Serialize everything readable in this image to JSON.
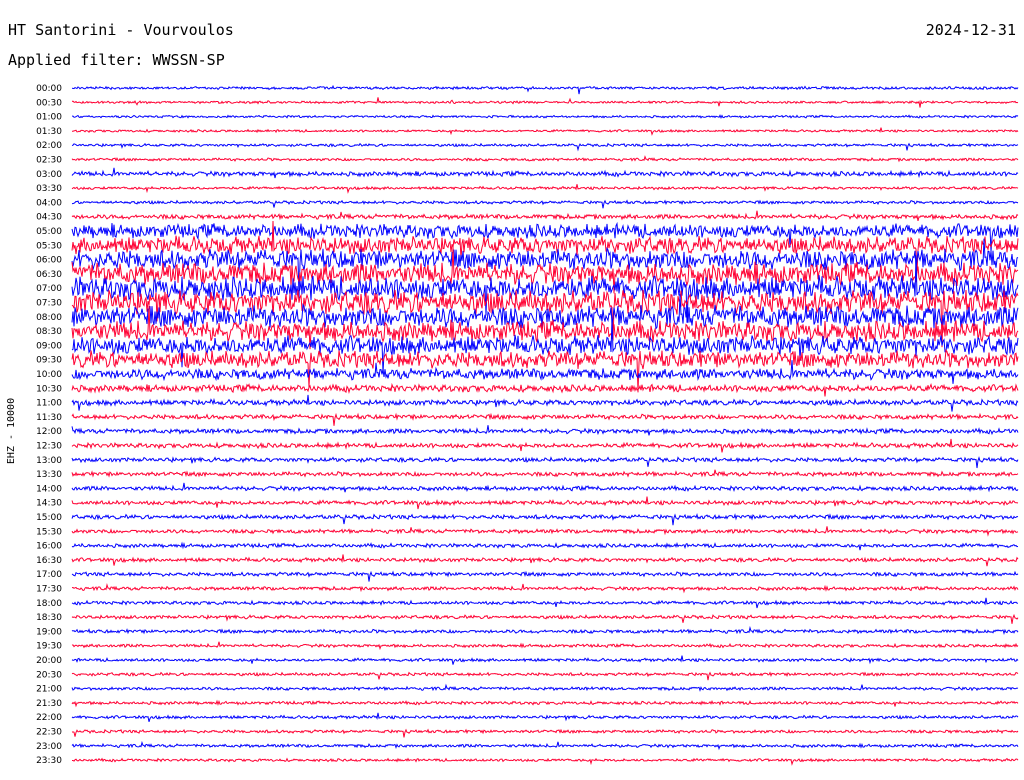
{
  "header": {
    "station_title": "HT Santorini - Vourvoulos",
    "date": "2024-12-31",
    "filter_label": "Applied filter:",
    "filter_value": "WWSSN-SP"
  },
  "axis": {
    "channel_label": "EHZ - 10000"
  },
  "colors": {
    "trace_a": "#0000ff",
    "trace_b": "#ff0033",
    "background": "#ffffff"
  },
  "chart_data": {
    "type": "line",
    "title": "HT Santorini - Vourvoulos",
    "ylabel": "EHZ - 10000",
    "categories": [
      "00:00",
      "00:30",
      "01:00",
      "01:30",
      "02:00",
      "02:30",
      "03:00",
      "03:30",
      "04:00",
      "04:30",
      "05:00",
      "05:30",
      "06:00",
      "06:30",
      "07:00",
      "07:30",
      "08:00",
      "08:30",
      "09:00",
      "09:30",
      "10:00",
      "10:30",
      "11:00",
      "11:30",
      "12:00",
      "12:30",
      "13:00",
      "13:30",
      "14:00",
      "14:30",
      "15:00",
      "15:30",
      "16:00",
      "16:30",
      "17:00",
      "17:30",
      "18:00",
      "18:30",
      "19:00",
      "19:30",
      "20:00",
      "20:30",
      "21:00",
      "21:30",
      "22:00",
      "22:30",
      "23:00",
      "23:30"
    ],
    "row_activity": [
      0.35,
      0.3,
      0.3,
      0.3,
      0.35,
      0.35,
      0.6,
      0.35,
      0.4,
      0.6,
      1.8,
      2.2,
      2.6,
      2.8,
      3.0,
      3.0,
      2.8,
      2.6,
      2.4,
      2.2,
      1.4,
      0.9,
      0.7,
      0.6,
      0.6,
      0.6,
      0.55,
      0.55,
      0.55,
      0.55,
      0.55,
      0.5,
      0.5,
      0.5,
      0.5,
      0.45,
      0.45,
      0.45,
      0.45,
      0.4,
      0.4,
      0.4,
      0.4,
      0.4,
      0.4,
      0.4,
      0.4,
      0.35
    ],
    "series": [
      {
        "color": "#0000ff"
      },
      {
        "color": "#ff0033"
      }
    ]
  }
}
